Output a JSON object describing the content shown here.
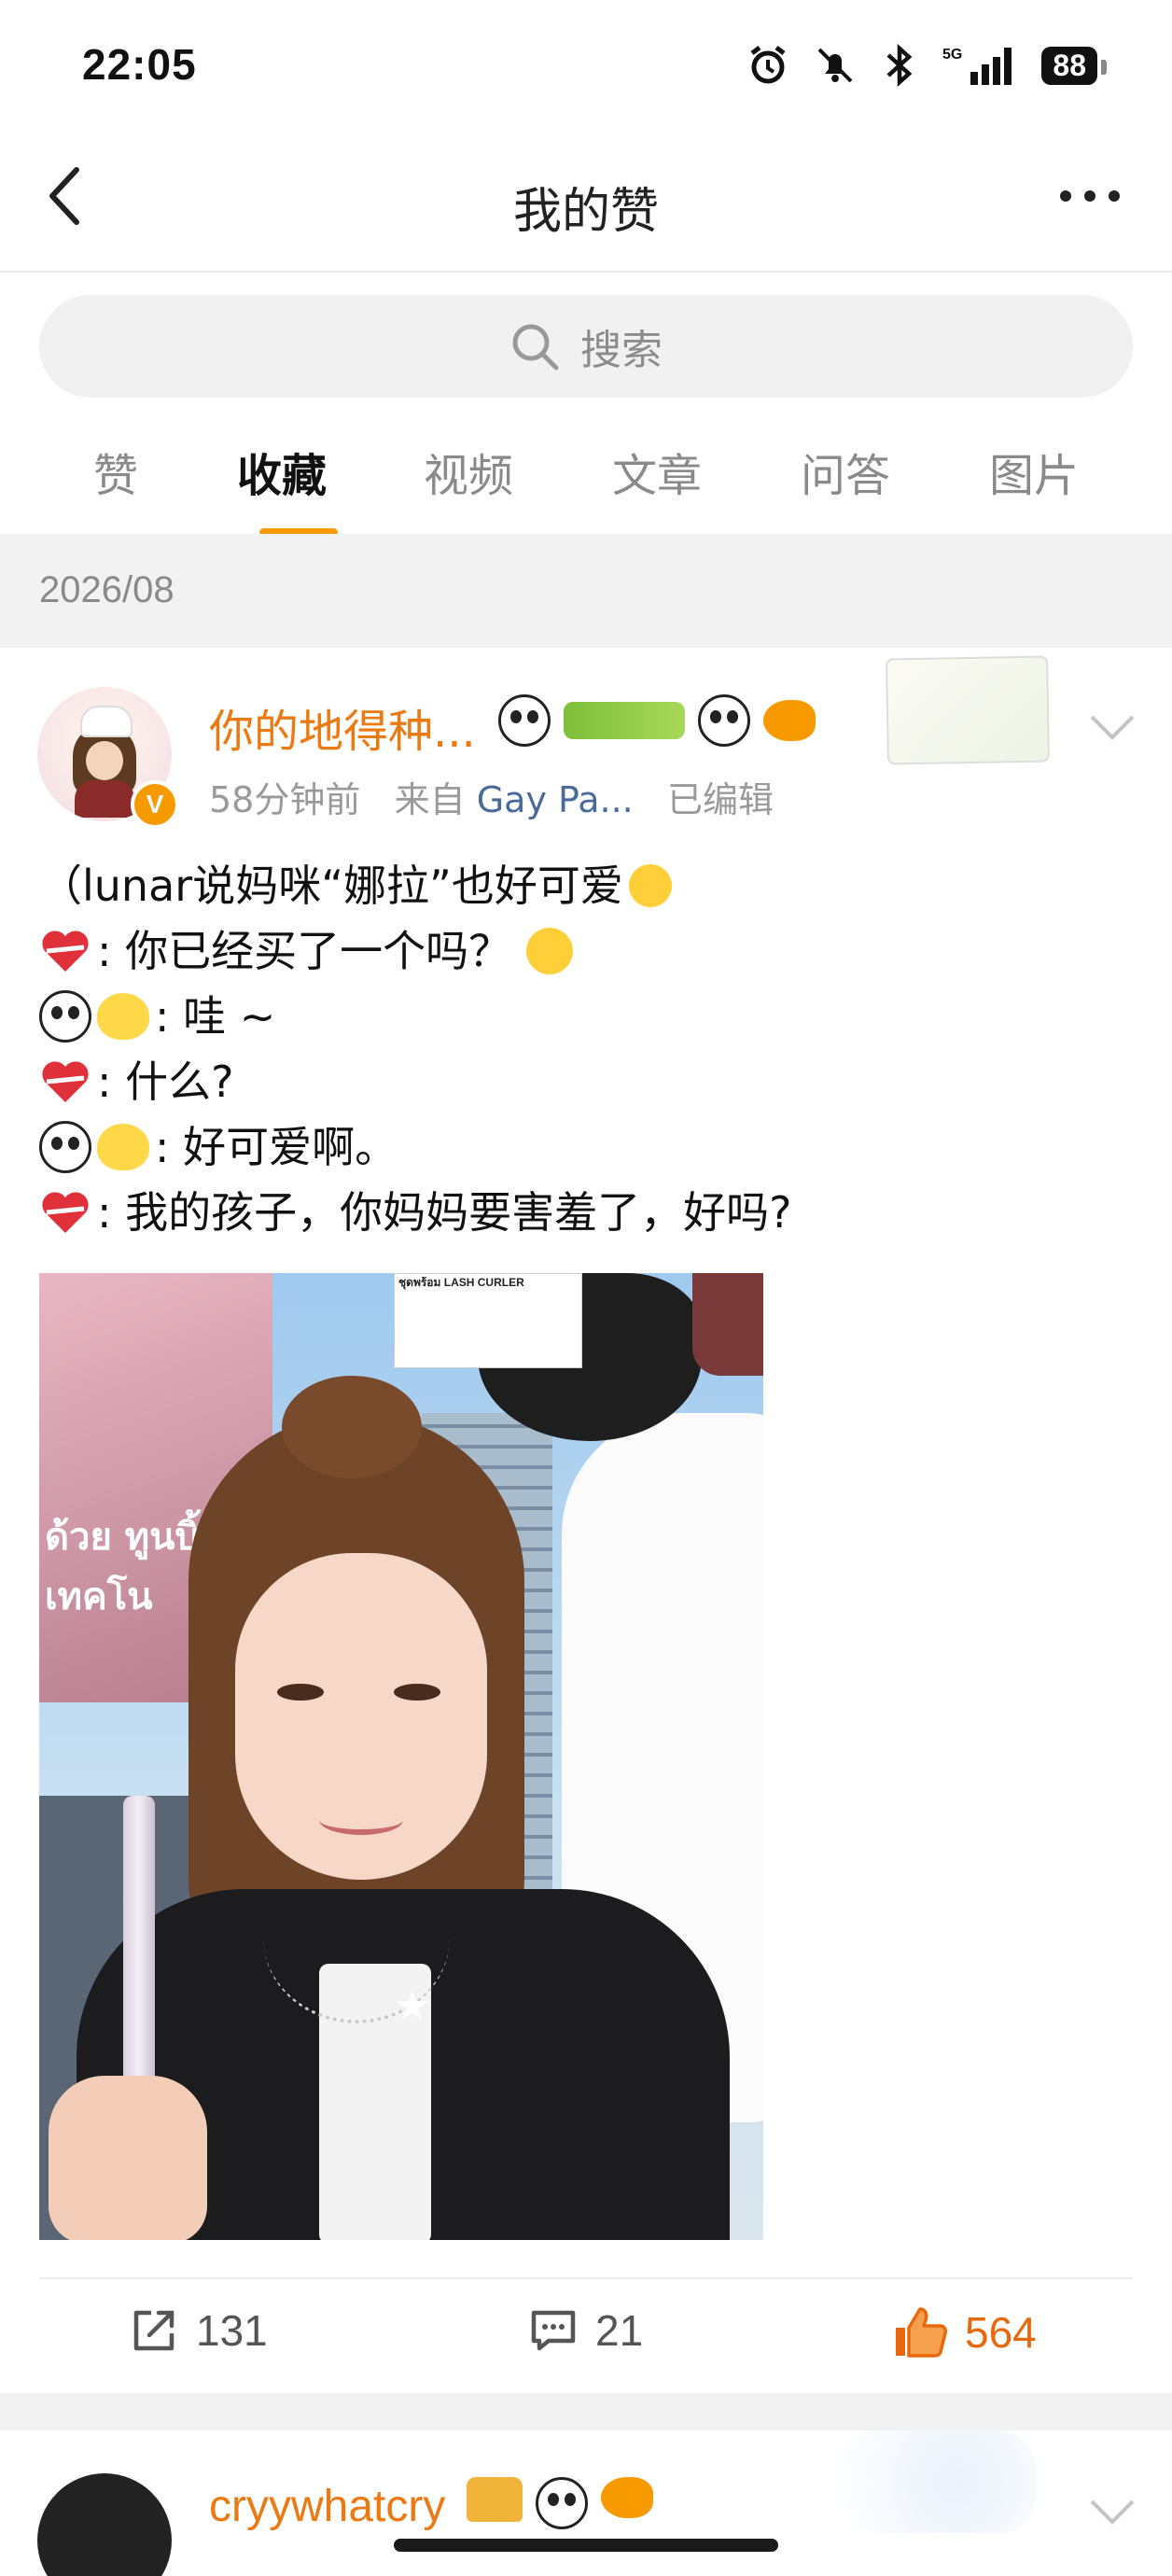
{
  "status_bar": {
    "time": "22:05",
    "battery": "88"
  },
  "nav": {
    "title": "我的赞"
  },
  "search": {
    "placeholder": "搜索"
  },
  "tabs": [
    {
      "label": "赞",
      "active": false
    },
    {
      "label": "收藏",
      "active": true
    },
    {
      "label": "视频",
      "active": false
    },
    {
      "label": "文章",
      "active": false
    },
    {
      "label": "问答",
      "active": false
    },
    {
      "label": "图片",
      "active": false
    }
  ],
  "date_group": "2026/08",
  "post": {
    "username": "你的地得种...",
    "time_ago": "58分钟前",
    "source_prefix": "来自",
    "source": "Gay Pa...",
    "edited": "已编辑",
    "verified_badge": "V",
    "lines": [
      "（lunar说妈咪“娜拉”也好可爱",
      ": 你已经买了一个吗？",
      ": 哇 ~",
      ": 什么?",
      ": 好可爱啊。",
      ": 我的孩子，你妈妈要害羞了，好吗?"
    ],
    "image_texts": {
      "billboard": "ด้วย ทูนบิ้ง เทคโน",
      "product": "ชุดพร้อม LASH CURLER"
    },
    "actions": {
      "repost": "131",
      "comment": "21",
      "like": "564"
    }
  },
  "next_post": {
    "username": "cryywhatcry"
  },
  "colors": {
    "accent": "#f79a00",
    "username": "#ec7a12",
    "like_active": "#e8690c",
    "link": "#4a6b9a"
  }
}
